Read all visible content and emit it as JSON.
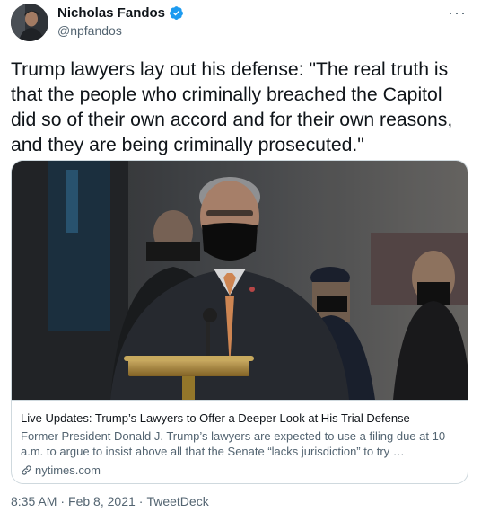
{
  "author": {
    "display_name": "Nicholas Fandos",
    "handle": "@npfandos",
    "verified": true
  },
  "more_menu": {
    "label": "···"
  },
  "tweet": {
    "text": "Trump lawyers lay out his defense: \"The real truth is that the people who criminally breached the Capitol did so of their own accord and for their own reasons, and they are being criminally prosecuted.\""
  },
  "card": {
    "title": "Live Updates: Trump’s Lawyers to Offer a Deeper Look at His Trial Defense",
    "description": "Former President Donald J. Trump’s lawyers are expected to use a filing due at 10 a.m. to argue to insist above all that the Senate “lacks jurisdiction” to try …",
    "domain": "nytimes.com"
  },
  "footer": {
    "time": "8:35 AM",
    "date": "Feb 8, 2021",
    "source": "TweetDeck",
    "separator": "·"
  },
  "colors": {
    "text_primary": "#0f1419",
    "text_secondary": "#536471",
    "verified_blue": "#1d9bf0",
    "border": "#cfd9de"
  }
}
